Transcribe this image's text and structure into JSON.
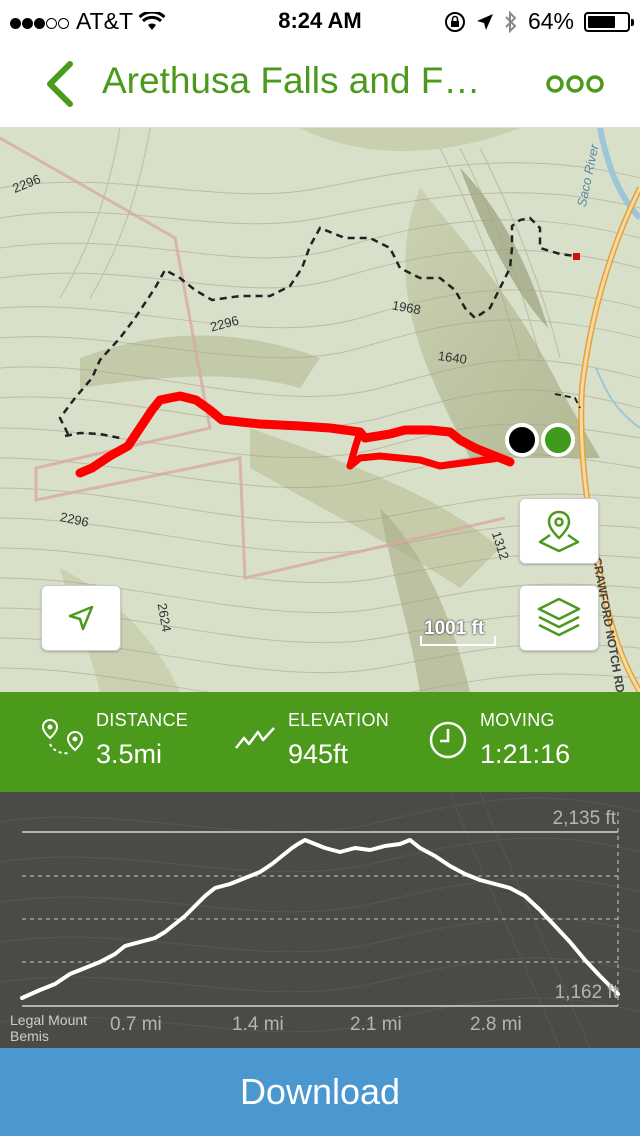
{
  "status_bar": {
    "carrier": "AT&T",
    "time": "8:24 AM",
    "battery": "64%"
  },
  "nav": {
    "title": "Arethusa Falls and F…"
  },
  "map": {
    "contour_labels": [
      "2296",
      "2296",
      "1968",
      "1640",
      "2296",
      "2624",
      "1312"
    ],
    "river_label": "Saco River",
    "road_label": "CRAWFORD NOTCH RD",
    "scale_label": "1001 ft",
    "colors": {
      "trail": "#ff0000",
      "start_marker": "#000000",
      "end_marker": "#3f9a1e"
    }
  },
  "stats": {
    "distance": {
      "label": "DISTANCE",
      "value": "3.5mi"
    },
    "elevation": {
      "label": "ELEVATION",
      "value": "945ft"
    },
    "moving": {
      "label": "MOVING",
      "value": "1:21:16"
    }
  },
  "profile": {
    "max_label": "2,135 ft",
    "min_label": "1,162 ft",
    "x_ticks": [
      "0.7 mi",
      "1.4 mi",
      "2.1 mi",
      "2.8 mi"
    ],
    "watermark": "Legal Mount Bemis"
  },
  "download_label": "Download"
}
